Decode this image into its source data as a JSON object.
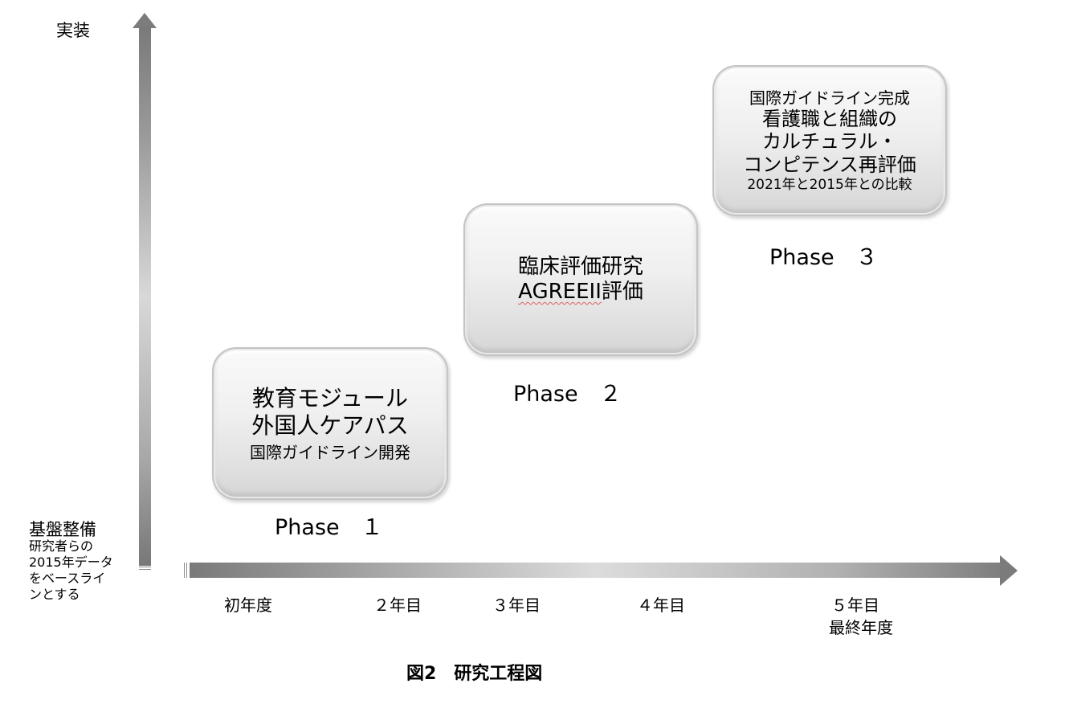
{
  "y_axis": {
    "top_label": "実装",
    "bottom_label": "基盤整備",
    "bottom_note": [
      "研究者らの",
      "2015年データ",
      "をベースライ",
      "ンとする"
    ]
  },
  "x_axis": {
    "ticks": [
      "初年度",
      "２年目",
      "３年目",
      "４年目",
      "５年目"
    ],
    "final_note": "最終年度"
  },
  "phases": [
    {
      "label": "Phase　１",
      "lines": [
        "教育モジュール",
        "外国人ケアパス",
        "国際ガイドライン開発"
      ]
    },
    {
      "label": "Phase　２",
      "lines": [
        "臨床評価研究",
        "AGREEII",
        "評価"
      ]
    },
    {
      "label": "Phase　３",
      "lines": [
        "国際ガイドライン完成",
        "看護職と組織の",
        "カルチュラル・",
        "コンピテンス再評価",
        "2021年と2015年との比較"
      ]
    }
  ],
  "caption": "図2　研究工程図"
}
